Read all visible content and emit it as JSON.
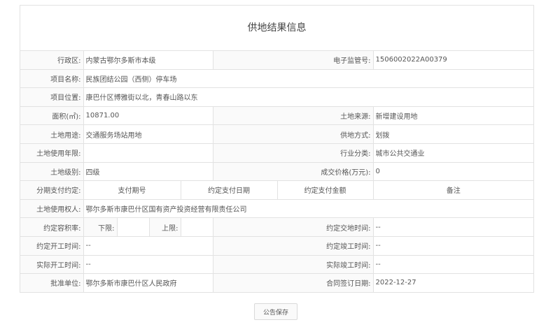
{
  "title": "供地结果信息",
  "labels": {
    "district": "行政区:",
    "supervision_no": "电子监管号:",
    "project_name": "项目名称:",
    "project_location": "项目位置:",
    "area": "面积(㎡):",
    "land_source": "土地来源:",
    "land_use": "土地用途:",
    "supply_method": "供地方式:",
    "use_term": "土地使用年限:",
    "industry": "行业分类:",
    "land_grade": "土地级别:",
    "price": "成交价格(万元):",
    "installments": "分期支付约定:",
    "land_user": "土地使用权人:",
    "far": "约定容积率:",
    "lower_limit": "下限:",
    "upper_limit": "上限:",
    "agreed_delivery": "约定交地时间:",
    "agreed_start": "约定开工时间:",
    "agreed_completion": "约定竣工时间:",
    "actual_start": "实际开工时间:",
    "actual_completion": "实际竣工时间:",
    "approval_unit": "批准单位:",
    "contract_date": "合同签订日期:"
  },
  "values": {
    "district": "内蒙古鄂尔多斯市本级",
    "supervision_no": "1506002022A00379",
    "project_name": "民族团结公园（西侧）停车场",
    "project_location": "康巴什区博雅街以北，青春山路以东",
    "area": "10871.00",
    "land_source": "新增建设用地",
    "land_use": "交通服务场站用地",
    "supply_method": "划拨",
    "use_term": "",
    "industry": "城市公共交通业",
    "land_grade": "四级",
    "price": "0",
    "land_user": "鄂尔多斯市康巴什区国有资产投资经营有限责任公司",
    "lower_limit": "",
    "upper_limit": "",
    "agreed_delivery": "--",
    "agreed_start": "--",
    "agreed_completion": "--",
    "actual_start": "--",
    "actual_completion": "--",
    "approval_unit": "鄂尔多斯市康巴什区人民政府",
    "contract_date": "2022-12-27"
  },
  "payment_columns": [
    "支付期号",
    "约定支付日期",
    "约定支付金额",
    "备注"
  ],
  "save_button": "公告保存"
}
